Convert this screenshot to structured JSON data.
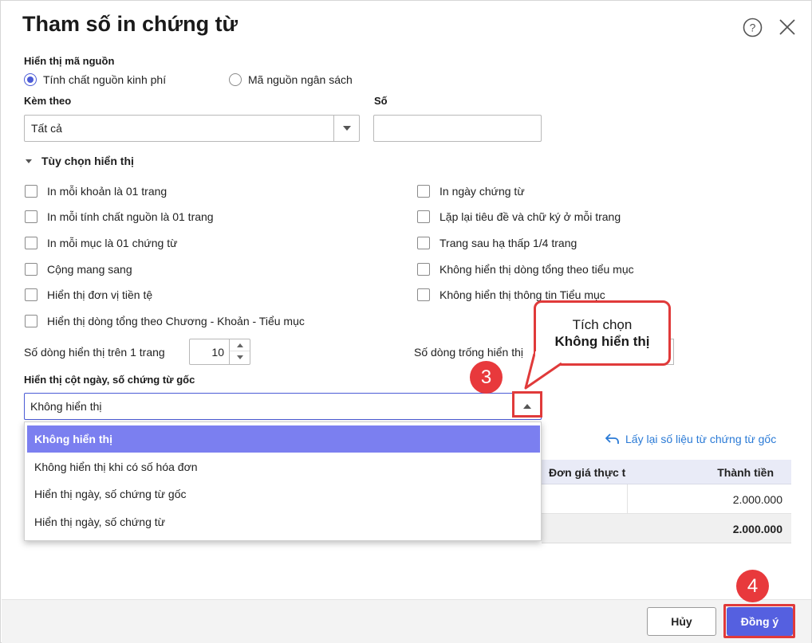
{
  "dialog": {
    "title": "Tham số in chứng từ"
  },
  "source_display": {
    "label": "Hiển thị mã nguồn",
    "options": [
      "Tính chất nguồn kinh phí",
      "Mã nguồn ngân sách"
    ],
    "selected_index": 0
  },
  "attach": {
    "label": "Kèm theo",
    "value": "Tất cả",
    "number_label": "Số",
    "number_value": ""
  },
  "options_section": {
    "label": "Tùy chọn hiển thị",
    "expanded": true,
    "left_checkboxes": [
      "In mỗi khoản là 01 trang",
      "In mỗi tính chất nguồn là 01 trang",
      "In mỗi mục là 01 chứng từ",
      "Cộng mang sang",
      "Hiển thị đơn vị tiền tệ",
      "Hiển thị dòng tổng theo Chương - Khoản - Tiểu mục"
    ],
    "right_checkboxes": [
      "In ngày chứng từ",
      "Lặp lại tiêu đề và chữ ký ở mỗi trang",
      "Trang sau hạ thấp 1/4 trang",
      "Không hiển thị dòng tổng theo tiểu mục",
      "Không hiển thị thông tin Tiểu mục"
    ],
    "rows_per_page_label": "Số dòng hiển thị trên 1 trang",
    "rows_per_page_value": "10",
    "blank_rows_label": "Số dòng trống hiển thị"
  },
  "date_column": {
    "label": "Hiển thị cột ngày, số chứng từ gốc",
    "value": "Không hiển thị",
    "dropdown_options": [
      "Không hiển thị",
      "Không hiển thị khi có số hóa đơn",
      "Hiển thị ngày, số chứng từ gốc",
      "Hiển thị ngày, số chứng từ"
    ],
    "selected_index": 0
  },
  "refresh_link": "Lấy lại số liệu từ chứng từ gốc",
  "grid": {
    "columns": [
      "Đơn giá thực t",
      "Thành tiền"
    ],
    "rows": [
      [
        "",
        "2.000.000"
      ]
    ],
    "total": "2.000.000"
  },
  "footer": {
    "cancel_label": "Hủy",
    "ok_label": "Đồng ý"
  },
  "annotations": {
    "step3": "3",
    "step4": "4",
    "callout_line1": "Tích chọn",
    "callout_line2": "Không hiển thị",
    "highlight_color": "#e03a3a"
  },
  "colors": {
    "accent": "#5560e0",
    "selected_item": "#7b7ff0",
    "link": "#2a7ad6"
  }
}
